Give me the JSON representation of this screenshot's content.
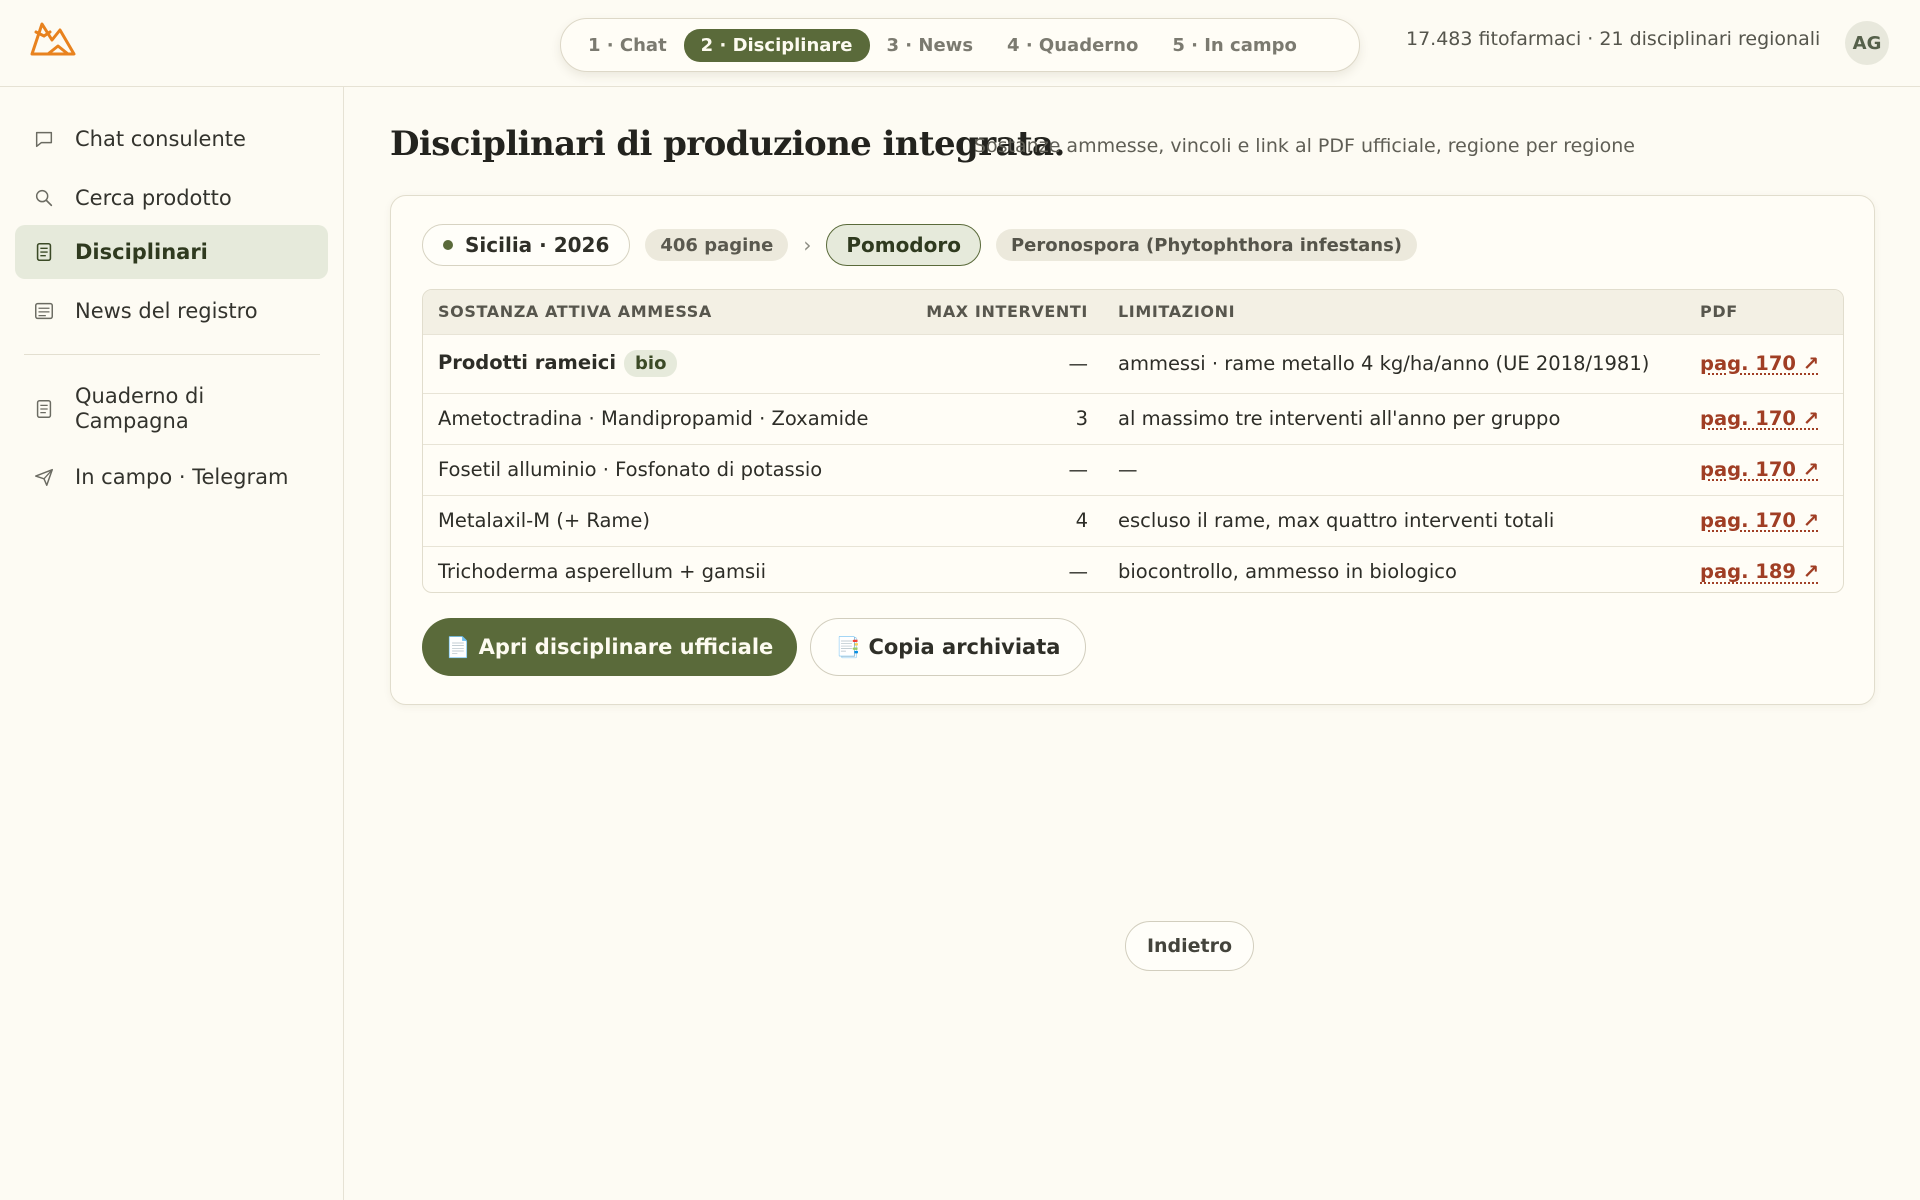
{
  "colors": {
    "accent": "#5a6a3a",
    "accent_light": "#e6eadb",
    "link": "#a03e24",
    "logo": "#e8821e",
    "background": "#fdfbf3"
  },
  "header": {
    "logo_icon": "mountain-logo-icon",
    "steps": [
      {
        "label": "1 · Chat",
        "active": false
      },
      {
        "label": "2 · Disciplinare",
        "active": true
      },
      {
        "label": "3 · News",
        "active": false
      },
      {
        "label": "4 · Quaderno",
        "active": false
      },
      {
        "label": "5 · In campo",
        "active": false
      }
    ],
    "stats": "17.483 fitofarmaci · 21 disciplinari regionali",
    "avatar": "AG"
  },
  "sidebar": {
    "items": [
      {
        "label": "Chat consulente",
        "icon": "chat-bubble-icon",
        "active": false
      },
      {
        "label": "Cerca prodotto",
        "icon": "search-icon",
        "active": false
      },
      {
        "label": "Disciplinari",
        "icon": "document-icon",
        "active": true
      },
      {
        "label": "News del registro",
        "icon": "news-icon",
        "active": false
      },
      {
        "label": "Quaderno di Campagna",
        "icon": "notebook-icon",
        "active": false
      },
      {
        "label": "In campo · Telegram",
        "icon": "send-icon",
        "active": false
      }
    ]
  },
  "main": {
    "title": "Disciplinari di produzione integrata.",
    "subtitle": "Sostanze ammesse, vincoli e link al PDF ufficiale, regione per regione",
    "filters": {
      "region": "Sicilia · 2026",
      "pages": "406 pagine",
      "separator": "›",
      "crop": "Pomodoro",
      "disease": "Peronospora (Phytophthora infestans)"
    },
    "table": {
      "headers": [
        "SOSTANZA ATTIVA AMMESSA",
        "MAX INTERVENTI",
        "LIMITAZIONI",
        "PDF"
      ],
      "rows": [
        {
          "substance": "Prodotti rameici",
          "badge": "bio",
          "max": "—",
          "limits": "ammessi · rame metallo 4 kg/ha/anno (UE 2018/1981)",
          "pdf": "pag. 170 ↗"
        },
        {
          "substance": "Ametoctradina · Mandipropamid · Zoxamide",
          "badge": "",
          "max": "3",
          "limits": "al massimo tre interventi all'anno per gruppo",
          "pdf": "pag. 170 ↗"
        },
        {
          "substance": "Fosetil alluminio · Fosfonato di potassio",
          "badge": "",
          "max": "—",
          "limits": "—",
          "pdf": "pag. 170 ↗"
        },
        {
          "substance": "Metalaxil-M (+ Rame)",
          "badge": "",
          "max": "4",
          "limits": "escluso il rame, max quattro interventi totali",
          "pdf": "pag. 170 ↗"
        },
        {
          "substance": "Trichoderma asperellum + gamsii",
          "badge": "",
          "max": "—",
          "limits": "biocontrollo, ammesso in biologico",
          "pdf": "pag. 189 ↗"
        }
      ]
    },
    "buttons": {
      "open_official": "Apri disciplinare ufficiale",
      "open_official_icon": "📄",
      "archived_copy": "Copia archiviata",
      "archived_copy_icon": "📑",
      "back": "Indietro"
    }
  }
}
